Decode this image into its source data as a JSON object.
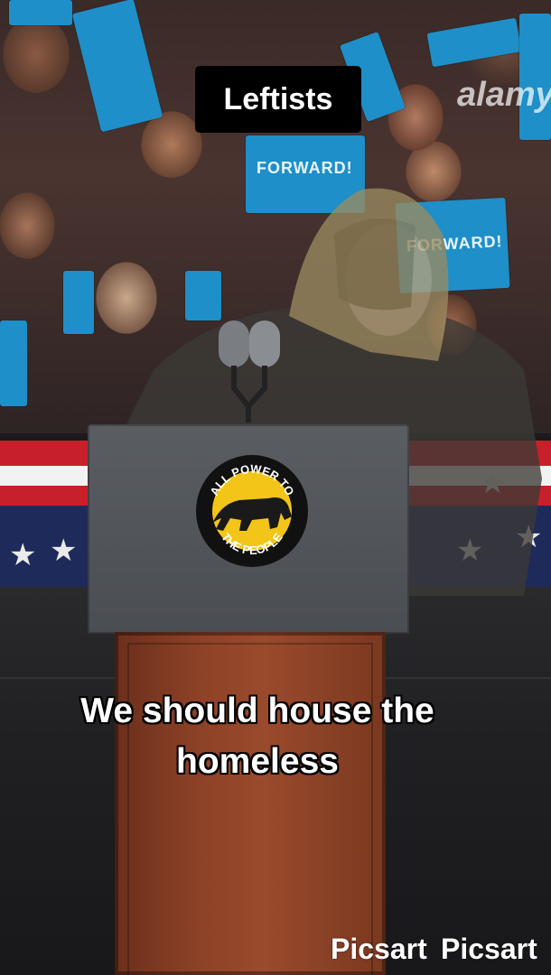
{
  "title": "Leftists",
  "caption_line1": "We should house the",
  "caption_line2": "homeless",
  "emblem": {
    "top_text": "ALL POWER TO",
    "bottom_text": "THE PEOPLE",
    "icon": "panther-icon"
  },
  "signs": {
    "text": "FORWARD!",
    "text_partial": "FORWARD!"
  },
  "watermarks": {
    "picsart_1": "Picsart",
    "picsart_2": "Picsart",
    "stock": "alamy"
  },
  "colors": {
    "sign_blue": "#1e8fc8",
    "emblem_yellow": "#f2c518",
    "title_bg": "#000000"
  }
}
